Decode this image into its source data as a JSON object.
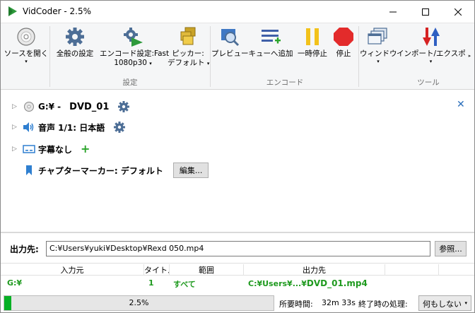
{
  "window": {
    "title": "VidCoder - 2.5%"
  },
  "ribbon": {
    "buttons": [
      {
        "label1": "ソースを開く",
        "label2": "",
        "dropdown": "▾",
        "icon": "disc-icon"
      },
      {
        "label1": "全般の設定",
        "label2": "",
        "dropdown": "",
        "icon": "gear-icon"
      },
      {
        "label1": "エンコード設定:Fast",
        "label2": "1080p30",
        "dropdown": "▾",
        "icon": "encode-settings-icon"
      },
      {
        "label1": "ピッカー:",
        "label2": "デフォルト",
        "dropdown": "▾",
        "icon": "picker-icon"
      },
      {
        "label1": "プレビュー",
        "label2": "",
        "dropdown": "",
        "icon": "preview-icon"
      },
      {
        "label1": "キューへ追加",
        "label2": "",
        "dropdown": "",
        "icon": "add-to-queue-icon"
      },
      {
        "label1": "一時停止",
        "label2": "",
        "dropdown": "",
        "icon": "pause-icon"
      },
      {
        "label1": "停止",
        "label2": "",
        "dropdown": "",
        "icon": "stop-icon"
      },
      {
        "label1": "ウィンドウ",
        "label2": "",
        "dropdown": "▾",
        "icon": "windows-icon"
      },
      {
        "label1": "インポート/エクスポー",
        "label2": "",
        "dropdown": "▾",
        "icon": "import-export-icon"
      }
    ],
    "groups": {
      "settings": "設定",
      "encode": "エンコード",
      "tools": "ツール"
    },
    "scroll_arrow": "▸"
  },
  "source": {
    "drive": "G:¥ -",
    "title": "DVD_01",
    "audio": "音声 1/1: 日本語",
    "subtitles": "字幕なし",
    "subtitles_add": "+",
    "chapter_markers": "チャプターマーカー: デフォルト",
    "edit_button": "編集...",
    "close": "✕",
    "expander": "▷"
  },
  "output": {
    "label": "出力先:",
    "path": "C:¥Users¥yuki¥Desktop¥Rexd 050.mp4",
    "browse": "参照..."
  },
  "queue": {
    "headers": [
      "入力元",
      "タイトル",
      "範囲",
      "出力先"
    ],
    "rows": [
      {
        "source": "G:¥",
        "title": "1",
        "range": "すべて",
        "dest_path": "C:¥Users¥...¥",
        "dest_file": "DVD_01.mp4"
      }
    ]
  },
  "status": {
    "progress_text": "2.5%",
    "progress_value": 0.025,
    "eta_label": "所要時間:",
    "eta_value": "32m 33s",
    "after_label": "終了時の処理:",
    "after_value": "何もしない",
    "after_dropdown": "▾"
  },
  "colors": {
    "accent_green": "#06b025",
    "queue_text_green": "#1f9a1f",
    "close_blue": "#2a6ebb"
  }
}
